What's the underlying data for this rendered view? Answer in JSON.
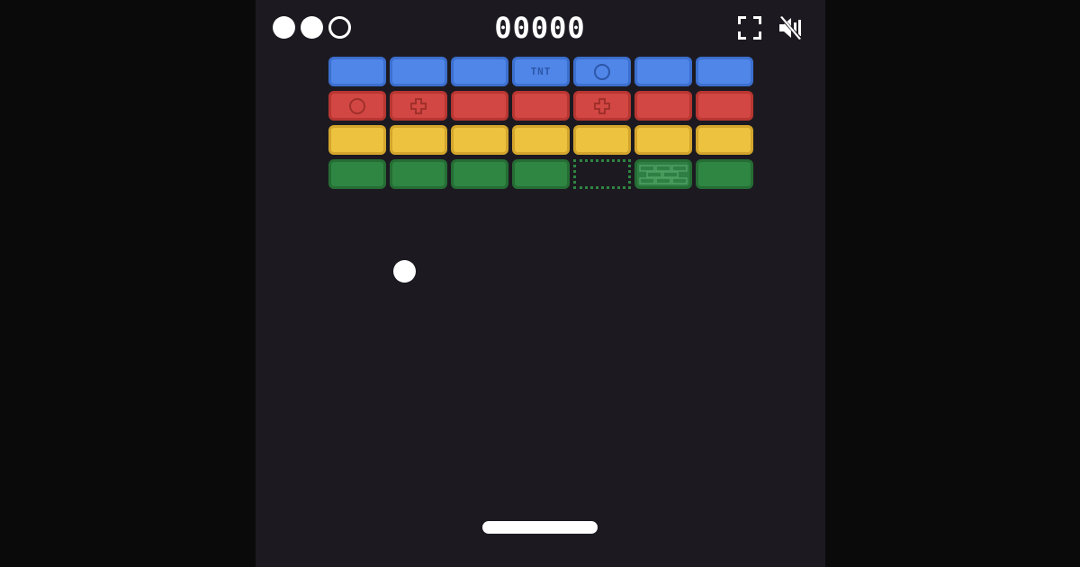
{
  "hud": {
    "score": "00000",
    "lives_total": 3,
    "lives_remaining": 2,
    "fullscreen_icon": "fullscreen-icon",
    "sound_icon": "sound-muted-icon"
  },
  "colors": {
    "background": "#1c1a20",
    "outer": "#0a0a0a",
    "blue": "#4f86e8",
    "red": "#d24743",
    "yellow": "#ecc23f",
    "green": "#2f8542",
    "ball": "#ffffff",
    "paddle": "#ffffff"
  },
  "bricks": {
    "rows": [
      [
        "blue",
        "blue",
        "blue",
        "blue-tnt",
        "blue-ball",
        "blue",
        "blue"
      ],
      [
        "red-ball",
        "red-plus",
        "red",
        "red",
        "red-plus",
        "red",
        "red"
      ],
      [
        "yellow",
        "yellow",
        "yellow",
        "yellow",
        "yellow",
        "yellow",
        "yellow"
      ],
      [
        "green",
        "green",
        "green",
        "green",
        "green-ghost",
        "green-stone",
        "green"
      ]
    ],
    "tnt_label": "TNT"
  }
}
